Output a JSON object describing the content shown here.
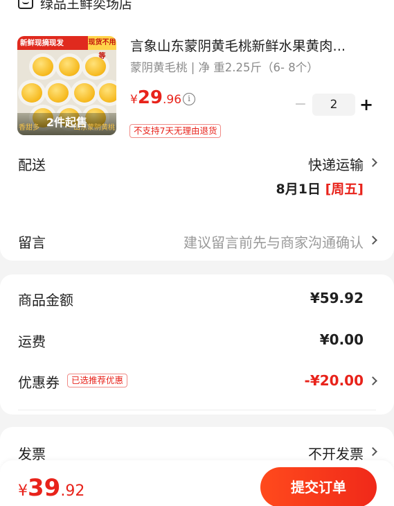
{
  "shop": {
    "name": "绿品王鲜奕场店",
    "icon": "shop-icon"
  },
  "product": {
    "title": "言象山东蒙阴黄毛桃新鲜水果黄肉...",
    "spec": "蒙阴黄毛桃 | 净 重2.25斤（6- 8个）",
    "price": {
      "symbol": "¥",
      "int": "29",
      "dec": ".96"
    },
    "thumb": {
      "tag_left": "新鲜现摘现发",
      "tag_right": "现货不用等",
      "min_order": "2件起售",
      "caption_left": "香甜多",
      "caption_right": "山东蒙阴黄桃"
    },
    "quantity": "2",
    "minus_label": "−",
    "plus_label": "+",
    "return_policy": "不支持7天无理由退货"
  },
  "delivery": {
    "label": "配送",
    "method": "快递运输",
    "date": "8月1日",
    "day": "[周五]"
  },
  "message": {
    "label": "留言",
    "placeholder": "建议留言前先与商家沟通确认"
  },
  "summary": {
    "goods_label": "商品金额",
    "goods_amount": "¥59.92",
    "shipping_label": "运费",
    "shipping_amount": "¥0.00",
    "coupon_label": "优惠券",
    "coupon_badge": "已选推荐优惠",
    "coupon_amount": "-¥20.00"
  },
  "invoice": {
    "label": "发票",
    "value": "不开发票"
  },
  "footer": {
    "total": {
      "symbol": "¥",
      "int": "39",
      "dec": ".92"
    },
    "submit_label": "提交订单"
  },
  "colors": {
    "accent": "#e8231b",
    "button": "#f0291a"
  }
}
